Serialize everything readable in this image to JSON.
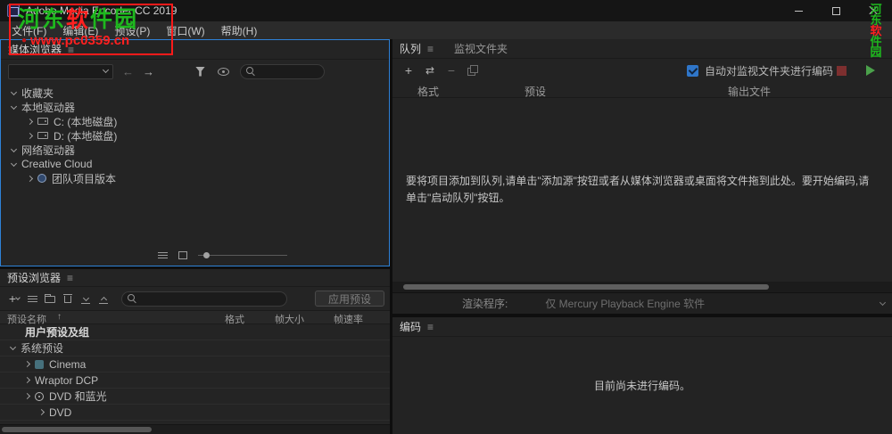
{
  "window": {
    "title": "Adobe Media Encoder CC 2019",
    "menu": [
      "文件(F)",
      "编辑(E)",
      "预设(P)",
      "窗口(W)",
      "帮助(H)"
    ]
  },
  "icons": {
    "panel_menu": "≡",
    "add": "+",
    "remove": "−",
    "swap": "⇄",
    "back": "←",
    "forward": "→",
    "sort": "↑"
  },
  "watermark": {
    "chars": [
      "河",
      "东",
      "软",
      "件",
      "园"
    ],
    "bullet": "●",
    "url": "www.pc0359.cn",
    "green": "#1eb81e",
    "red": "#ff2020"
  },
  "media_browser": {
    "title": "媒体浏览器",
    "tree": [
      {
        "label": "收藏夹"
      },
      {
        "label": "本地驱动器"
      },
      {
        "label": "C: (本地磁盘)"
      },
      {
        "label": "D: (本地磁盘)"
      },
      {
        "label": "网络驱动器"
      },
      {
        "label": "Creative Cloud"
      },
      {
        "label": "团队项目版本"
      }
    ]
  },
  "preset_browser": {
    "title": "预设浏览器",
    "apply_button": "应用预设",
    "columns": {
      "name": "预设名称",
      "format": "格式",
      "frame_size": "帧大小",
      "frame_rate": "帧速率"
    },
    "rows": [
      {
        "label": "用户预设及组"
      },
      {
        "label": "系统预设"
      },
      {
        "label": "Cinema"
      },
      {
        "label": "Wraptor DCP"
      },
      {
        "label": "DVD 和蓝光"
      },
      {
        "label": "DVD"
      }
    ]
  },
  "queue": {
    "tab_queue": "队列",
    "tab_watch": "监视文件夹",
    "auto_encode_label": "自动对监视文件夹进行编码",
    "columns": {
      "format": "格式",
      "preset": "预设",
      "output": "输出文件"
    },
    "empty_message": "要将项目添加到队列,请单击\"添加源\"按钮或者从媒体浏览器或桌面将文件拖到此处。要开始编码,请单击\"启动队列\"按钮。",
    "renderer_label": "渲染程序:",
    "renderer_value": "仅 Mercury Playback Engine 软件"
  },
  "encoding": {
    "title": "编码",
    "empty_message": "目前尚未进行编码。"
  }
}
